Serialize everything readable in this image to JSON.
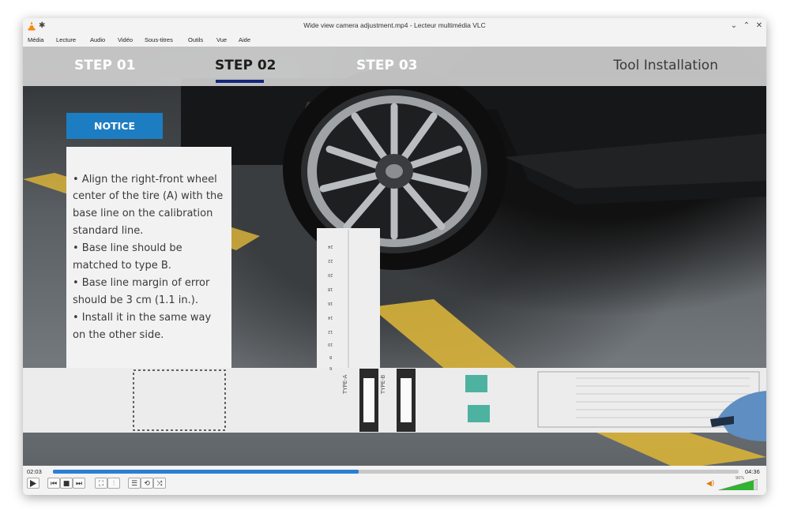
{
  "window": {
    "title": "Wide view camera adjustment.mp4 - Lecteur multimédia VLC",
    "controls": [
      "⌄",
      "⌃",
      "✕"
    ]
  },
  "menu": [
    "Média",
    "Lecture",
    "Audio",
    "Vidéo",
    "Sous-titres",
    "Outils",
    "Vue",
    "Aide"
  ],
  "video": {
    "steps": [
      "STEP 01",
      "STEP 02",
      "STEP 03"
    ],
    "active_step": 1,
    "section_title": "Tool Installation",
    "notice_label": "NOTICE",
    "notice_lines": [
      "• Align the right-front wheel",
      "center of the tire (A) with the",
      "base line on the calibration",
      "standard line.",
      "• Base line should be",
      "matched to type B.",
      "• Base line margin of error",
      "should be 3 cm (1.1 in.).",
      "• Install it in the same way",
      "on the other side."
    ],
    "ruler_numbers": [
      "24",
      "22",
      "20",
      "18",
      "16",
      "14",
      "12",
      "10",
      "8",
      "6"
    ],
    "mat_labels": [
      "TYPE-A",
      "TYPE-B"
    ]
  },
  "player": {
    "elapsed": "02:03",
    "total": "04:36",
    "progress": 0.446,
    "volume_label": "90%",
    "volume": 0.9
  },
  "colors": {
    "accent": "#2a7fd4",
    "notice": "#1d7dc3",
    "underline": "#13287a",
    "volume": "#2fb52f"
  },
  "icons": {
    "app": "vlc-cone-icon",
    "play": "play-icon",
    "prev": "previous-icon",
    "stop": "stop-icon",
    "next": "next-icon",
    "fullscreen": "fullscreen-icon",
    "extended": "equalizer-icon",
    "playlist": "playlist-icon",
    "loop": "loop-icon",
    "shuffle": "shuffle-icon",
    "volume": "speaker-icon"
  }
}
